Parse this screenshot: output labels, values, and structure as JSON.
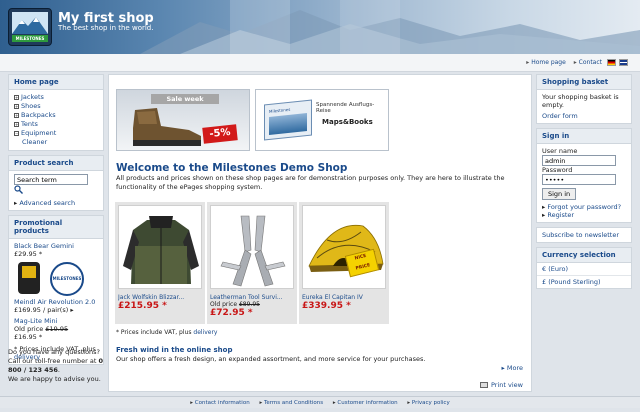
{
  "header": {
    "title": "My first shop",
    "subtitle": "The best shop in the world.",
    "logo_text": "MILESTONES"
  },
  "topbar": {
    "links": [
      "Home page",
      "Contact"
    ]
  },
  "categories": {
    "title": "Home page",
    "items": [
      {
        "label": "Jackets",
        "marker": "+"
      },
      {
        "label": "Shoes",
        "marker": "+"
      },
      {
        "label": "Backpacks",
        "marker": "+"
      },
      {
        "label": "Tents",
        "marker": "+"
      },
      {
        "label": "Equipment",
        "marker": "−"
      }
    ],
    "subitem": "Cleaner"
  },
  "search": {
    "title": "Product search",
    "value": "Search term",
    "advanced": "Advanced search"
  },
  "promo": {
    "title": "Promotional products",
    "item1_name": "Black Bear Gemini",
    "item1_price": "£29.95",
    "item2_name": "Meindl Air Revolution 2.0",
    "item2_price": "£169.95 / pair(s)",
    "item3_name": "Mag-Lite Mini",
    "item3_old_label": "Old price",
    "item3_old_price": "£19.95",
    "item3_price": "£16.95",
    "vat_note": "* Prices include VAT, plus",
    "delivery": "delivery",
    "seal_text": "MILESTONES"
  },
  "help": {
    "line1": "Do you have any questions?",
    "line2": "Call our toll-free number at",
    "phone": "0 800 / 123 456",
    "line3": "We are happy to advise you."
  },
  "banners": {
    "b1_label": "Sale week",
    "b1_discount": "-5%",
    "b2_title": "Spannende Ausflugs-Reise",
    "b2_text": "Maps&Books"
  },
  "welcome": {
    "title": "Welcome to the Milestones Demo Shop",
    "text": "All products and prices shown on these shop pages are for demonstration purposes only. They are here to illustrate the functionality of the ePages shopping system."
  },
  "products": [
    {
      "name": "Jack Wolfskin Blizzar...",
      "old_label": "",
      "old_price": "",
      "price": "£215.95 *"
    },
    {
      "name": "Leatherman Tool Survi...",
      "old_label": "Old price",
      "old_price": "£89.95",
      "price": "£72.95 *"
    },
    {
      "name": "Eureka El Capitan IV",
      "old_label": "",
      "old_price": "",
      "price": "£339.95 *"
    }
  ],
  "tent_badge": "NICE PRICE",
  "footnote": {
    "text": "* Prices include VAT, plus",
    "link": "delivery"
  },
  "news": {
    "title": "Fresh wind in the online shop",
    "text": "Our shop offers a fresh design, an expanded assortment, and more service for your purchases.",
    "more": "More",
    "print": "Print view"
  },
  "basket": {
    "title": "Shopping basket",
    "text": "Your shopping basket is empty.",
    "link": "Order form"
  },
  "signin": {
    "title": "Sign in",
    "user_label": "User name",
    "user_value": "admin",
    "password_label": "Password",
    "password_value": "•••••",
    "button": "Sign in",
    "forgot": "Forgot your password?",
    "register": "Register"
  },
  "newsletter": "Subscribe to newsletter",
  "currency": {
    "title": "Currency selection",
    "options": [
      "€ (Euro)",
      "£ (Pound Sterling)"
    ]
  },
  "footer": {
    "links": [
      "Contact information",
      "Terms and Conditions",
      "Customer information",
      "Privacy policy"
    ]
  }
}
